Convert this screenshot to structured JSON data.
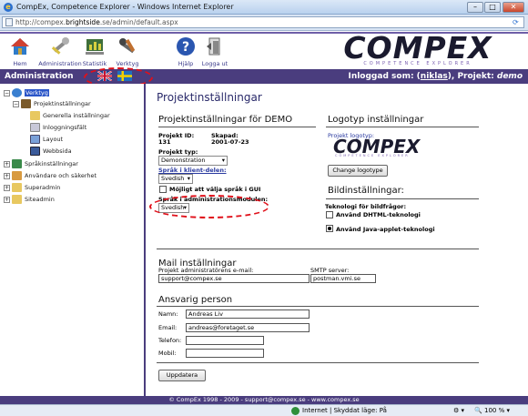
{
  "window": {
    "title": "CompEx, Competence Explorer - Windows Internet Explorer",
    "minimize": "–",
    "maximize": "□",
    "close": "✕"
  },
  "address": {
    "url_prefix": "http://compex.",
    "url_domain": "brightside",
    "url_suffix": ".se/admin/default.aspx"
  },
  "topnav": {
    "items": [
      {
        "label": "Hem",
        "icon": "home-icon"
      },
      {
        "label": "Administration",
        "icon": "wrench-icon"
      },
      {
        "label": "Statistik",
        "icon": "chart-icon"
      },
      {
        "label": "Verktyg",
        "icon": "tools-icon"
      },
      {
        "label": "Hjälp",
        "icon": "help-icon"
      },
      {
        "label": "Logga ut",
        "icon": "logout-icon"
      }
    ],
    "logo": "COMPEX",
    "logo_sub": "COMPETENCE EXPLORER"
  },
  "band": {
    "admin_label": "Administration",
    "logged_prefix": "Inloggad som: (",
    "user": "niklas",
    "logged_mid": "), Projekt: ",
    "project": "demo"
  },
  "sidebar": {
    "tree": [
      {
        "label": "Verktyg",
        "level": 0,
        "exp": "−"
      },
      {
        "label": "Projektinställningar",
        "level": 1,
        "exp": "−"
      },
      {
        "label": "Generella inställningar",
        "level": 2,
        "exp": ""
      },
      {
        "label": "Inloggningsfält",
        "level": 2,
        "exp": ""
      },
      {
        "label": "Layout",
        "level": 2,
        "exp": ""
      },
      {
        "label": "Webbsida",
        "level": 2,
        "exp": ""
      },
      {
        "label": "Språkinställningar",
        "level": 1,
        "exp": "+"
      },
      {
        "label": "Användare och säkerhet",
        "level": 1,
        "exp": "+"
      },
      {
        "label": "Superadmin",
        "level": 1,
        "exp": "+"
      },
      {
        "label": "Siteadmin",
        "level": 1,
        "exp": "+"
      }
    ]
  },
  "main": {
    "page_title": "Projektinställningar",
    "proj_settings_title": "Projektinställningar för DEMO",
    "project_id_label": "Projekt ID:",
    "project_id": "131",
    "created_label": "Skapad:",
    "created": "2001-07-23",
    "project_type_label": "Projekt typ:",
    "project_type": "Demonstration",
    "client_lang_label": "Språk i klient-delen:",
    "client_lang": "Svedish",
    "allow_lang_label": "Möjligt att välja språk i GUI",
    "admin_lang_label": "Språk i administrationsmodulen:",
    "admin_lang": "Svedish",
    "logo_title": "Logotyp inställningar",
    "project_logo_label": "Projekt logotyp:",
    "mini_logo": "COMPEX",
    "mini_logo_sub": "COMPETENCE EXPLORER",
    "change_logo_btn": "Change logotype",
    "image_title": "Bildinställningar:",
    "tech_label": "Teknologi för bildfrågor:",
    "dhtml_label": "Använd DHTML-teknologi",
    "java_label": "Använd Java-applet-teknologi",
    "mail_title": "Mail inställningar",
    "admin_email_label": "Projekt administratörens e-mail:",
    "admin_email": "support@compex.se",
    "smtp_label": "SMTP server:",
    "smtp": "postman.vmi.se",
    "resp_title": "Ansvarig person",
    "name_label": "Namn:",
    "name": "Andreas Liv",
    "email_label": "Email:",
    "email": "andreas@foretaget.se",
    "phone_label": "Telefon:",
    "phone": "",
    "mobile_label": "Mobil:",
    "mobile": "",
    "update_btn": "Uppdatera"
  },
  "footer": "© CompEx 1998 - 2009 - support@compex.se - www.compex.se",
  "status": {
    "zone": "Internet | Skyddat läge: På",
    "zoom": "100 %",
    "zoom_icon": "🔍"
  },
  "colors": {
    "band": "#4a3d7e",
    "link": "#2a3aa0",
    "annotation": "#e0101a"
  }
}
